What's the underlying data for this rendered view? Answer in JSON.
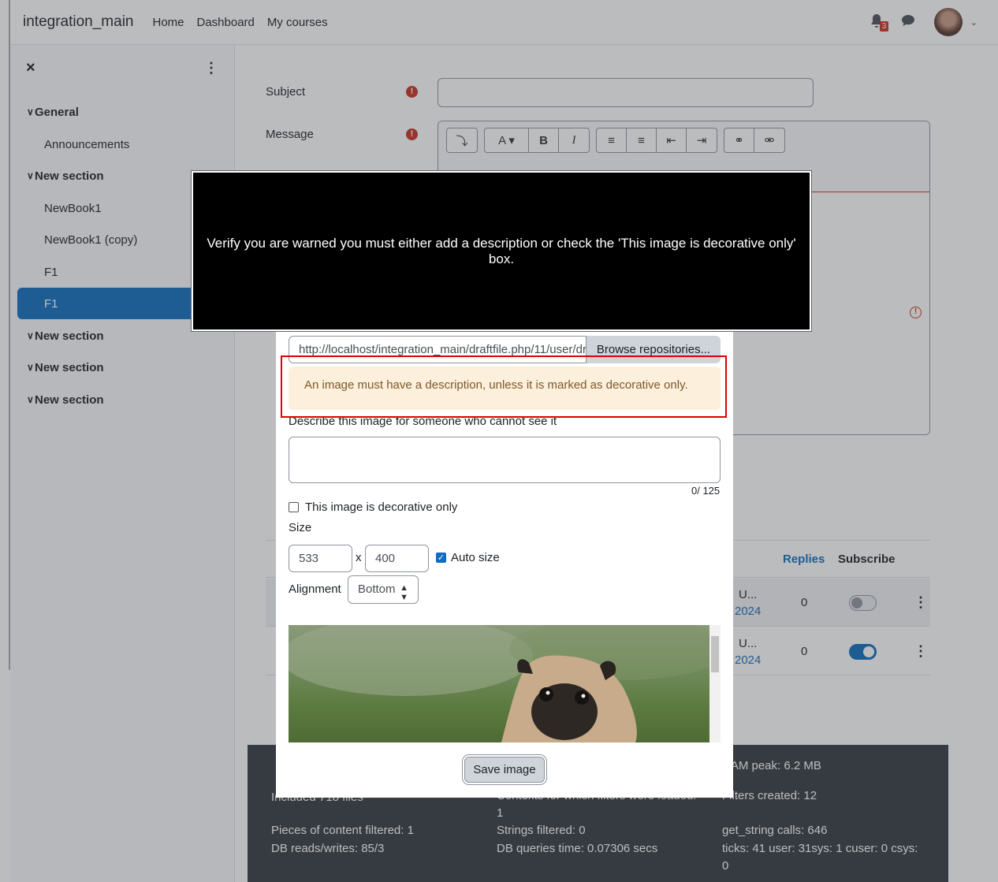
{
  "topbar": {
    "brand": "integration_main",
    "nav": [
      "Home",
      "Dashboard",
      "My courses"
    ],
    "notification_count": "3"
  },
  "drawer": {
    "items": [
      {
        "label": "General",
        "type": "section"
      },
      {
        "label": "Announcements",
        "type": "item"
      },
      {
        "label": "New section",
        "type": "section"
      },
      {
        "label": "NewBook1",
        "type": "item"
      },
      {
        "label": "NewBook1 (copy)",
        "type": "item"
      },
      {
        "label": "F1",
        "type": "item"
      },
      {
        "label": "F1",
        "type": "item-active"
      },
      {
        "label": "New section",
        "type": "section"
      },
      {
        "label": "New section",
        "type": "section"
      },
      {
        "label": "New section",
        "type": "section"
      }
    ]
  },
  "form": {
    "subject_label": "Subject",
    "message_label": "Message"
  },
  "table": {
    "col_replies": "Replies",
    "col_subscribe": "Subscribe",
    "rows": [
      {
        "author": "U...",
        "date_tail": "2024",
        "replies": "0",
        "subscribed": false
      },
      {
        "author": "U...",
        "date_tail": "2024",
        "replies": "0",
        "subscribed": true
      }
    ]
  },
  "footer": {
    "col1": [
      "Included 718 files",
      "Pieces of content filtered: 1",
      "DB reads/writes: 85/3"
    ],
    "col2": [
      "Contexts for which filters were loaded:",
      "1",
      "Strings filtered: 0",
      "DB queries time: 0.07306 secs"
    ],
    "col3": [
      "RAM peak: 6.2 MB",
      "Filters created: 12",
      "get_string calls: 646",
      "ticks: 41 user: 31sys: 1 cuser: 0 csys:",
      "0"
    ]
  },
  "modal": {
    "url_value": "http://localhost/integration_main/draftfile.php/11/user/draft/",
    "browse_label": "Browse repositories...",
    "warning": "An image must have a description, unless it is marked as decorative only.",
    "desc_label": "Describe this image for someone who cannot see it",
    "counter": "0/ 125",
    "decorative_label": "This image is decorative only",
    "size_label": "Size",
    "width": "533",
    "height": "400",
    "size_x": "x",
    "auto_size_label": "Auto size",
    "alignment_label": "Alignment",
    "alignment_value": "Bottom",
    "save_label": "Save image"
  },
  "instruction": "Verify you are warned you must either add a description or check the 'This image is decorative only' box."
}
